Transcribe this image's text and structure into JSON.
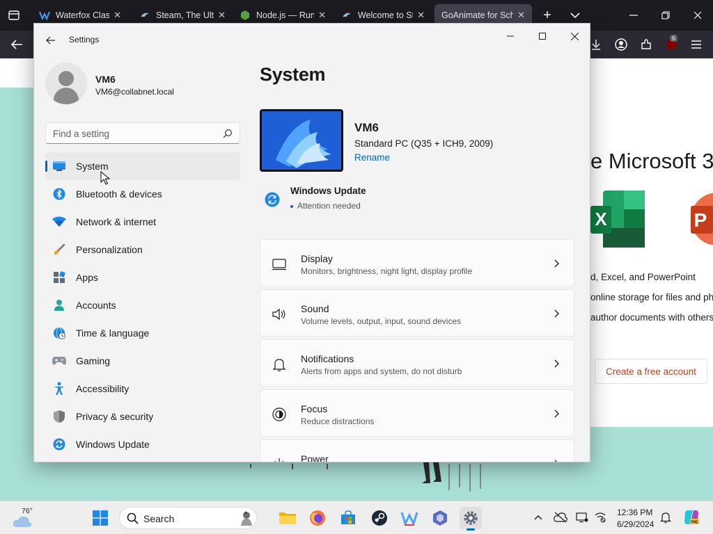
{
  "browser": {
    "tabs": [
      {
        "title": "Waterfox Classic",
        "active": false
      },
      {
        "title": "Steam, The Ultimate",
        "active": false
      },
      {
        "title": "Node.js — Run",
        "active": false
      },
      {
        "title": "Welcome to Steam",
        "active": false
      },
      {
        "title": "GoAnimate for Schools",
        "active": true
      }
    ],
    "downloads_badge": "6",
    "accent": "#1c1b22"
  },
  "webpage": {
    "title": "e Microsoft 3",
    "features": [
      "d, Excel, and PowerPoint",
      "online storage for files and ph",
      "author documents with others"
    ],
    "cta": "Create a free account"
  },
  "settings": {
    "window_title": "Settings",
    "user": {
      "name": "VM6",
      "email": "VM6@collabnet.local"
    },
    "search_placeholder": "Find a setting",
    "nav": [
      {
        "label": "System",
        "icon": "system-icon",
        "active": true
      },
      {
        "label": "Bluetooth & devices",
        "icon": "bluetooth-icon"
      },
      {
        "label": "Network & internet",
        "icon": "wifi-icon"
      },
      {
        "label": "Personalization",
        "icon": "brush-icon"
      },
      {
        "label": "Apps",
        "icon": "apps-icon"
      },
      {
        "label": "Accounts",
        "icon": "person-icon"
      },
      {
        "label": "Time & language",
        "icon": "globe-clock-icon"
      },
      {
        "label": "Gaming",
        "icon": "gamepad-icon"
      },
      {
        "label": "Accessibility",
        "icon": "accessibility-icon"
      },
      {
        "label": "Privacy & security",
        "icon": "shield-icon"
      },
      {
        "label": "Windows Update",
        "icon": "update-icon"
      }
    ],
    "content_title": "System",
    "device": {
      "name": "VM6",
      "model": "Standard PC (Q35 + ICH9, 2009)",
      "rename": "Rename"
    },
    "windows_update": {
      "title": "Windows Update",
      "status": "Attention needed"
    },
    "rows": [
      {
        "title": "Display",
        "subtitle": "Monitors, brightness, night light, display profile",
        "icon": "monitor-icon"
      },
      {
        "title": "Sound",
        "subtitle": "Volume levels, output, input, sound devices",
        "icon": "speaker-icon"
      },
      {
        "title": "Notifications",
        "subtitle": "Alerts from apps and system, do not disturb",
        "icon": "bell-icon"
      },
      {
        "title": "Focus",
        "subtitle": "Reduce distractions",
        "icon": "focus-icon"
      },
      {
        "title": "Power",
        "subtitle": "",
        "icon": "power-icon"
      }
    ],
    "accent": "#0067c0"
  },
  "taskbar": {
    "weather_temp": "76°",
    "search_label": "Search",
    "time": "12:36 PM",
    "date": "6/29/2024"
  }
}
